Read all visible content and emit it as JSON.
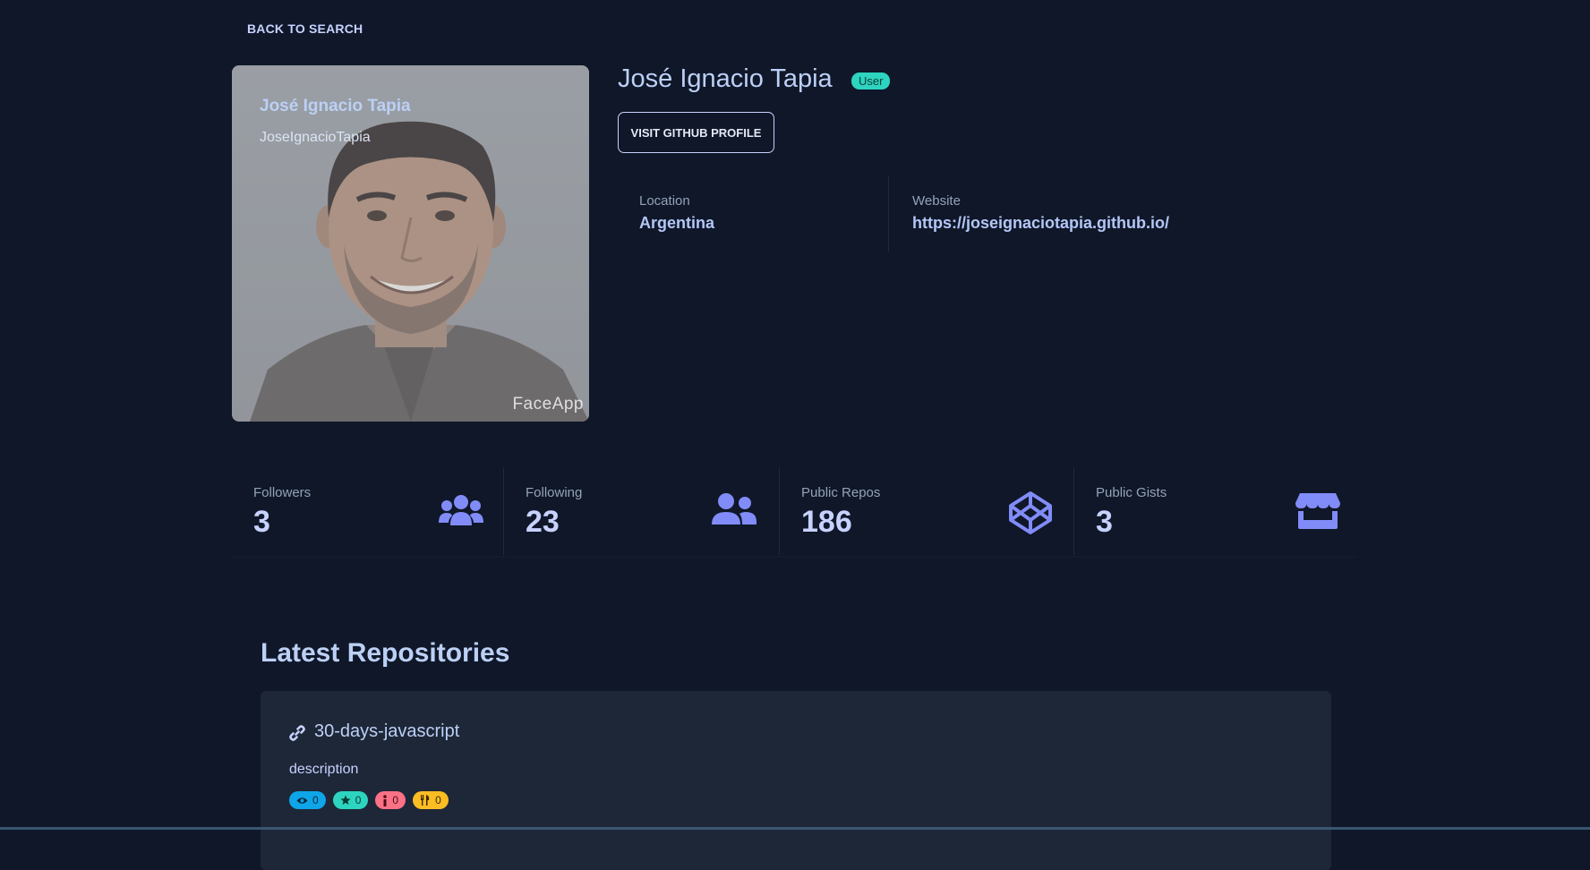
{
  "nav": {
    "back_label": "BACK TO SEARCH"
  },
  "avatar": {
    "name": "José Ignacio Tapia",
    "login": "JoseIgnacioTapia",
    "watermark": "FaceApp"
  },
  "profile": {
    "name": "José Ignacio Tapia",
    "type_badge": "User",
    "visit_button": "VISIT GITHUB PROFILE",
    "location_label": "Location",
    "location_value": "Argentina",
    "website_label": "Website",
    "website_value": "https://joseignaciotapia.github.io/"
  },
  "stats": [
    {
      "label": "Followers",
      "value": "3",
      "icon": "users-icon"
    },
    {
      "label": "Following",
      "value": "23",
      "icon": "user-friends-icon"
    },
    {
      "label": "Public Repos",
      "value": "186",
      "icon": "codepen-icon"
    },
    {
      "label": "Public Gists",
      "value": "3",
      "icon": "store-icon"
    }
  ],
  "repos": {
    "title": "Latest Repositories",
    "items": [
      {
        "name": "30-days-javascript",
        "description": "description",
        "watchers": "0",
        "stars": "0",
        "issues": "0",
        "forks": "0"
      }
    ]
  },
  "colors": {
    "background": "#0f1729",
    "accent": "#818cf8",
    "text": "#c7d2fe",
    "card": "#1e2738"
  }
}
